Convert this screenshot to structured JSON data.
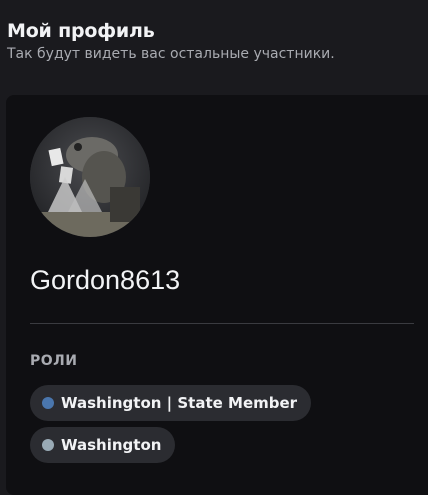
{
  "header": {
    "title": "Мой профиль",
    "subtitle": "Так будут видеть вас остальные участники."
  },
  "profile": {
    "avatar_icon": "avatar-photo-icon",
    "username": "Gordon8613"
  },
  "roles": {
    "label": "РОЛИ",
    "items": [
      {
        "name": "Washington | State Member",
        "color": "#4a76ad"
      },
      {
        "name": "Washington",
        "color": "#99aab5"
      }
    ]
  },
  "colors": {
    "background": "#1a1a1e",
    "card": "#0f0f12",
    "pill": "#2b2c31"
  }
}
